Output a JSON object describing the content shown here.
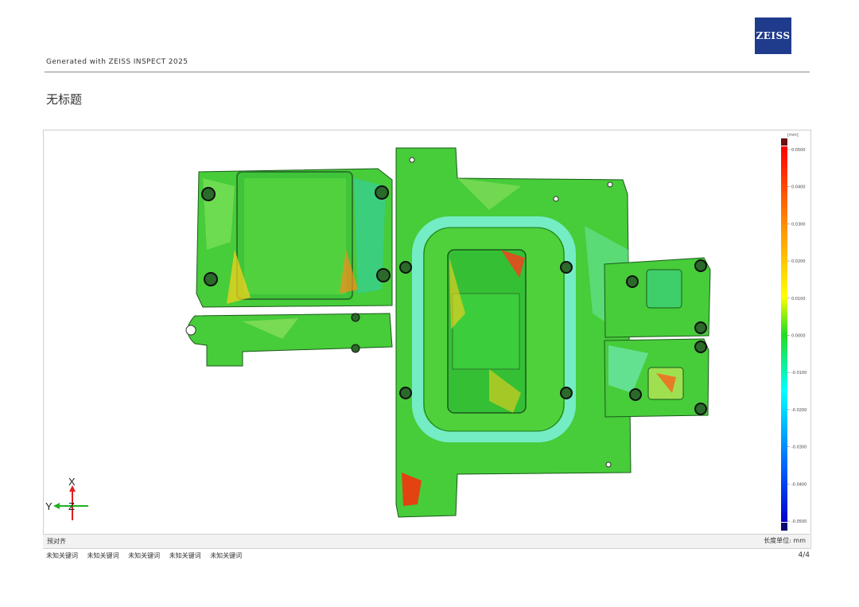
{
  "header": {
    "logo_text": "ZEISS",
    "generated": "Generated with ZEISS INSPECT 2025",
    "page_title": "无标题"
  },
  "color_scale": {
    "unit": "[mm]",
    "ticks": [
      "0.0500",
      "0.0400",
      "0.0300",
      "0.0200",
      "0.0100",
      "0.0000",
      "-0.0100",
      "-0.0200",
      "-0.0300",
      "-0.0400",
      "-0.0500"
    ],
    "over_color": "#6b1010",
    "under_color": "#0a0a6e"
  },
  "axes": {
    "x": "X",
    "y": "Y",
    "z": "Z"
  },
  "footer": {
    "alignment": "预对齐",
    "unit_label": "长度单位: ",
    "unit_value": "mm",
    "keywords": [
      "未知关键词",
      "未知关键词",
      "未知关键词",
      "未知关键词",
      "未知关键词"
    ],
    "page": "4/4"
  },
  "colors": {
    "brand": "#1f3b8c",
    "part_green": "#4ccf3a"
  }
}
